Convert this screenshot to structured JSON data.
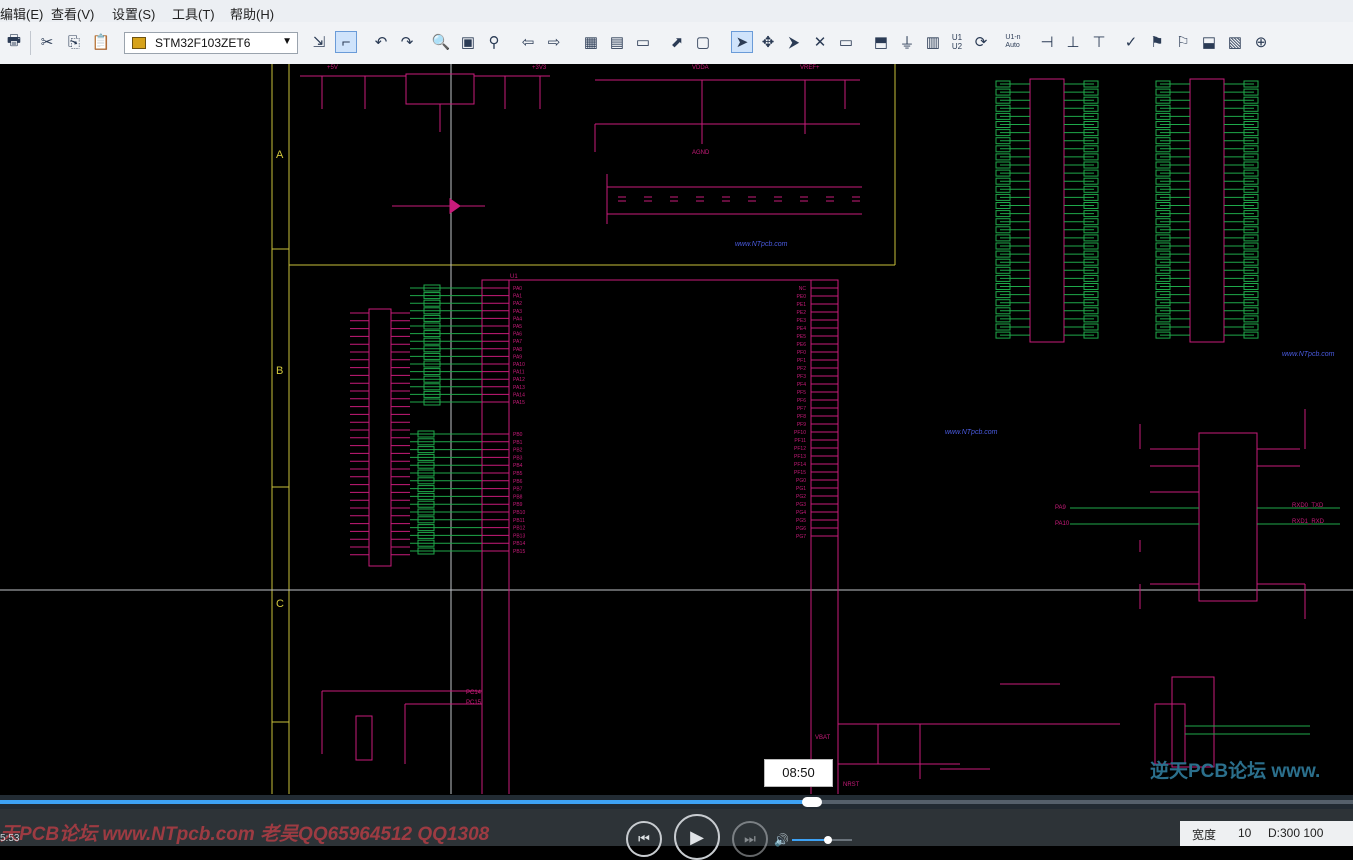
{
  "menu": [
    "编辑(E)",
    "查看(V)",
    "设置(S)",
    "工具(T)",
    "帮助(H)"
  ],
  "toolbar": {
    "part_value": "STM32F103ZET6",
    "wire_labels": [
      "U1\nU2",
      "U1-n\nAuto"
    ]
  },
  "schematic": {
    "zones": [
      "A",
      "B",
      "C"
    ],
    "ic_ref": "U1",
    "watermarks": [
      "www.NTpcb.com",
      "www.NTpcb.com",
      "www.NTpcb.com"
    ],
    "forum_watermark": "逆天PCB论坛 www.",
    "left_pins": [
      "PA0",
      "PA1",
      "PA2",
      "PA3",
      "PA4",
      "PA5",
      "PA6",
      "PA7",
      "PA8",
      "PA9",
      "PA10",
      "PA11",
      "PA12",
      "PA13",
      "PA14",
      "PA15",
      "PB0",
      "PB1",
      "PB2",
      "PB3",
      "PB4",
      "PB5",
      "PB6",
      "PB7",
      "PB8",
      "PB9",
      "PB10",
      "PB11",
      "PB12",
      "PB13",
      "PB14",
      "PB15"
    ],
    "right_pins": [
      "NC",
      "PE0",
      "PE1",
      "PE2",
      "PE3",
      "PE4",
      "PE5",
      "PE6",
      "PF0",
      "PF1",
      "PF2",
      "PF3",
      "PF4",
      "PF5",
      "PF6",
      "PF7",
      "PF8",
      "PF9",
      "PF10",
      "PF11",
      "PF12",
      "PF13",
      "PF14",
      "PF15",
      "PG0",
      "PG1",
      "PG2",
      "PG3",
      "PG4",
      "PG5",
      "PG6",
      "PG7"
    ],
    "net_labels": [
      "+3V3",
      "+5V",
      "AGND",
      "VDDA",
      "VREF+",
      "RXD0_TXD",
      "RXD1_RXD",
      "PA9",
      "PA10",
      "PC14",
      "PC15",
      "VBAT",
      "NRST"
    ]
  },
  "player": {
    "tooltip_time": "08:50",
    "current_time": "5:53",
    "progress_fraction": 0.6,
    "volume_fraction": 0.6,
    "bottom_watermark": "天PCB论坛 www.NTpcb.com  老吴QQ65964512  QQ1308"
  },
  "status": {
    "width_label": "宽度",
    "width_value": "10",
    "coords": "D:300 100"
  }
}
